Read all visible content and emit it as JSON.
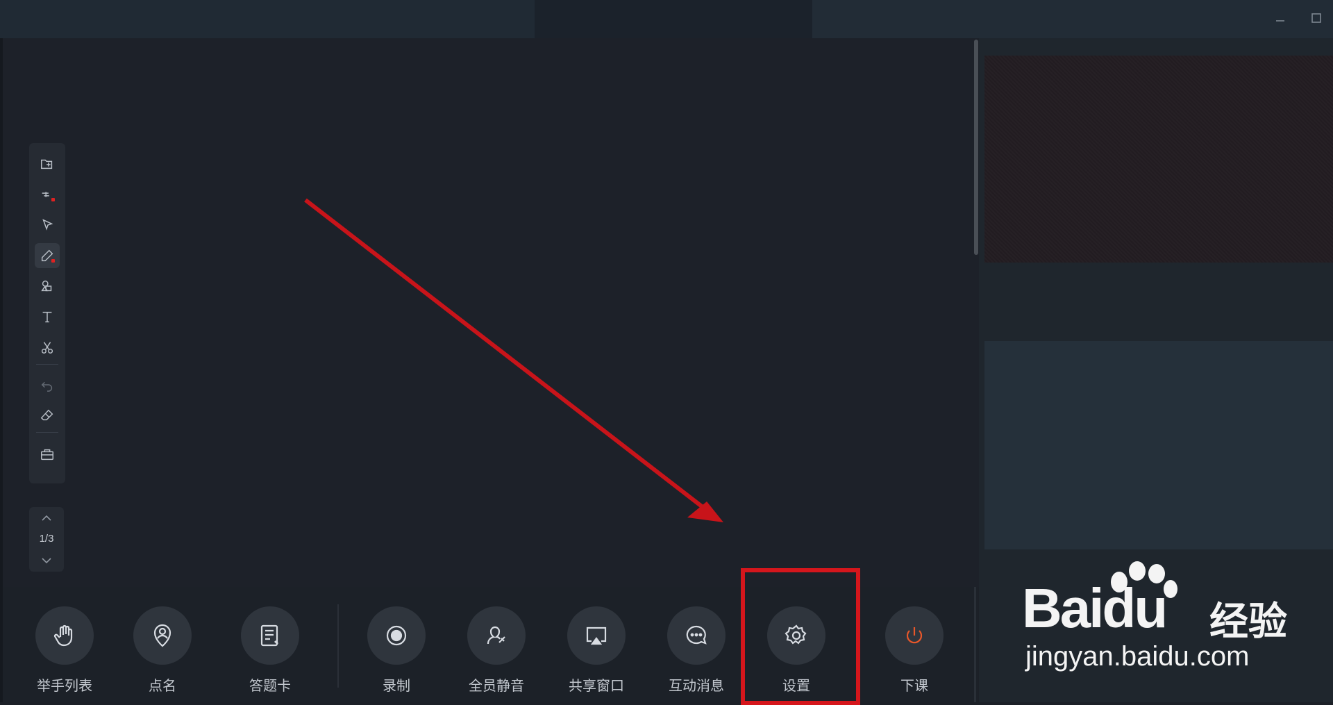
{
  "window": {
    "controls": [
      "minimize-icon",
      "maximize-icon"
    ]
  },
  "whiteboard_tools": [
    {
      "icon": "add-page-icon"
    },
    {
      "icon": "laser-pointer-icon"
    },
    {
      "icon": "select-arrow-icon"
    },
    {
      "icon": "pen-icon",
      "active": true
    },
    {
      "icon": "shapes-icon"
    },
    {
      "icon": "text-icon"
    },
    {
      "icon": "scissors-icon"
    },
    {
      "icon": "undo-icon",
      "disabled": true
    },
    {
      "icon": "eraser-icon"
    },
    {
      "icon": "toolbox-icon"
    }
  ],
  "pager": {
    "current": "1",
    "total": "3",
    "text": "1/3"
  },
  "bottom_bar": [
    {
      "label": "举手列表",
      "icon": "raise-hand-icon"
    },
    {
      "label": "点名",
      "icon": "location-user-icon"
    },
    {
      "label": "答题卡",
      "icon": "answer-card-icon"
    },
    {
      "label": "录制",
      "icon": "record-icon"
    },
    {
      "label": "全员静音",
      "icon": "mute-all-icon"
    },
    {
      "label": "共享窗口",
      "icon": "share-window-icon"
    },
    {
      "label": "互动消息",
      "icon": "chat-icon"
    },
    {
      "label": "设置",
      "icon": "gear-icon",
      "highlighted": true
    },
    {
      "label": "下课",
      "icon": "power-icon",
      "accent": "#e8572a"
    }
  ],
  "watermark": {
    "logo": "Baidu",
    "brand": "经验",
    "url": "jingyan.baidu.com"
  },
  "annotation_color": "#d5161c"
}
